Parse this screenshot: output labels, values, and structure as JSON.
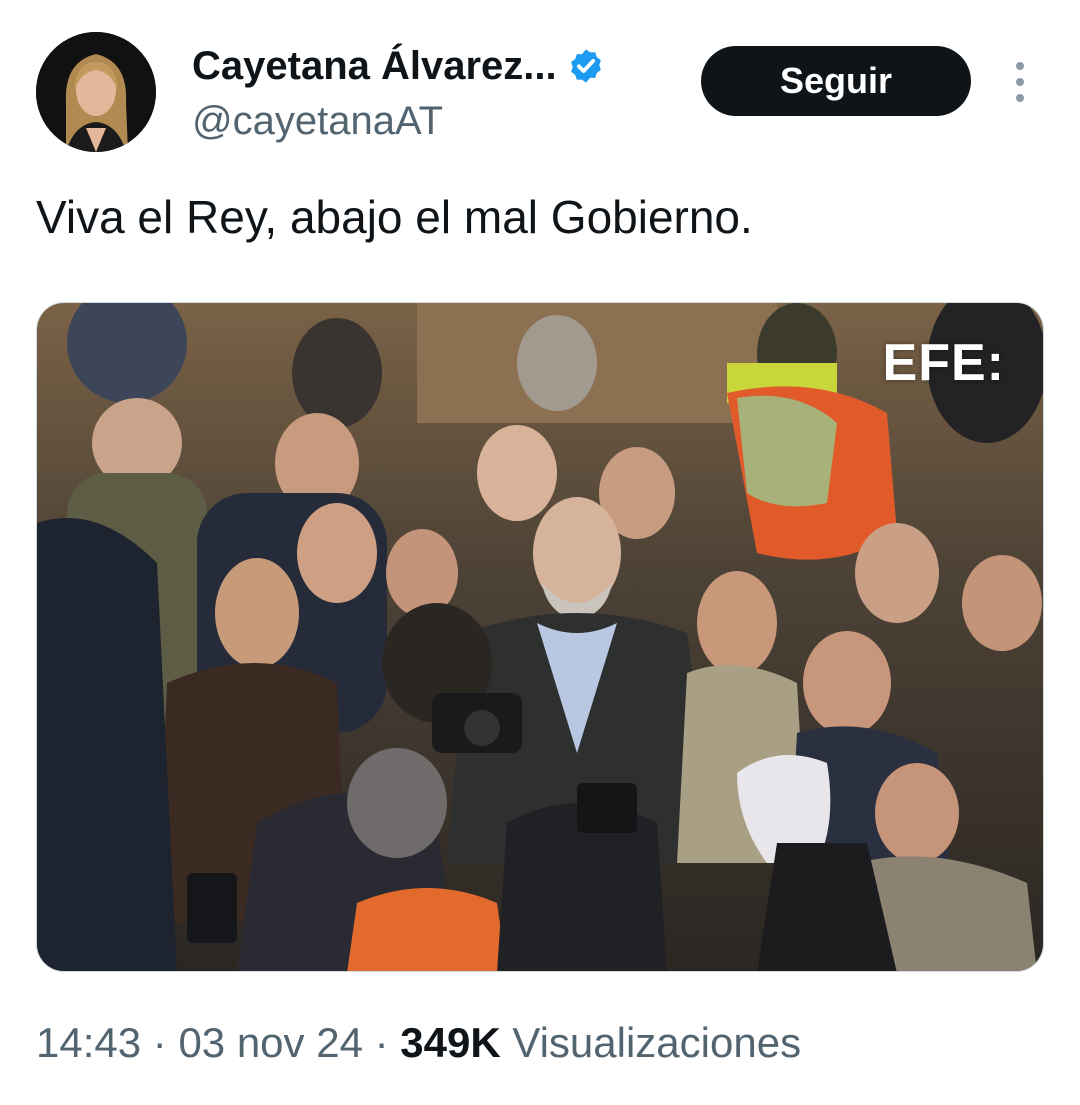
{
  "author": {
    "display_name": "Cayetana Álvarez...",
    "handle": "@cayetanaAT",
    "verified": true,
    "verified_color": "#1d9bf0"
  },
  "follow_button": {
    "label": "Seguir"
  },
  "more_icon": "more-vertical-icon",
  "tweet": {
    "text": "Viva el Rey, abajo el mal Gobierno.",
    "media": {
      "watermark": "EFE:"
    }
  },
  "meta": {
    "time": "14:43",
    "separator": " · ",
    "date": "03 nov 24",
    "views_count": "349K",
    "views_label": "Visualizaciones"
  }
}
